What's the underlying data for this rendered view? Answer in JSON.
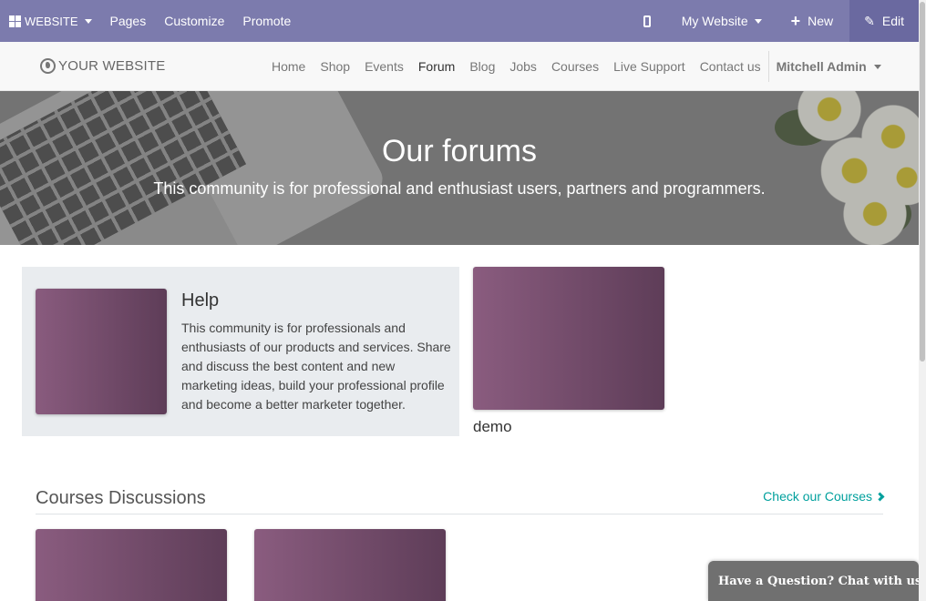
{
  "adminbar": {
    "app_menu_label": "WEBSITE",
    "menu": [
      "Pages",
      "Customize",
      "Promote"
    ],
    "website_selector": "My Website",
    "new_label": "New",
    "edit_label": "Edit"
  },
  "navbar": {
    "logo_text": "YOUR WEBSITE",
    "links": [
      "Home",
      "Shop",
      "Events",
      "Forum",
      "Blog",
      "Jobs",
      "Courses",
      "Live Support",
      "Contact us"
    ],
    "active_link": "Forum",
    "user_name": "Mitchell Admin"
  },
  "hero": {
    "title": "Our forums",
    "subtitle": "This community is for professional and enthusiast users, partners and programmers."
  },
  "forums": [
    {
      "name": "Help",
      "description": "This community is for professionals and enthusiasts of our products and services. Share and discuss the best content and new marketing ideas, build your professional profile and become a better marketer together."
    },
    {
      "name": "demo",
      "description": ""
    }
  ],
  "courses_section": {
    "title": "Courses Discussions",
    "link_label": "Check our Courses"
  },
  "livechat": {
    "label": "Have a Question? Chat with us."
  },
  "colors": {
    "adminbar": "#7c7bad",
    "accent": "#00A09D",
    "card_gradient_start": "#8a5c7f",
    "card_gradient_end": "#5e3d58"
  }
}
